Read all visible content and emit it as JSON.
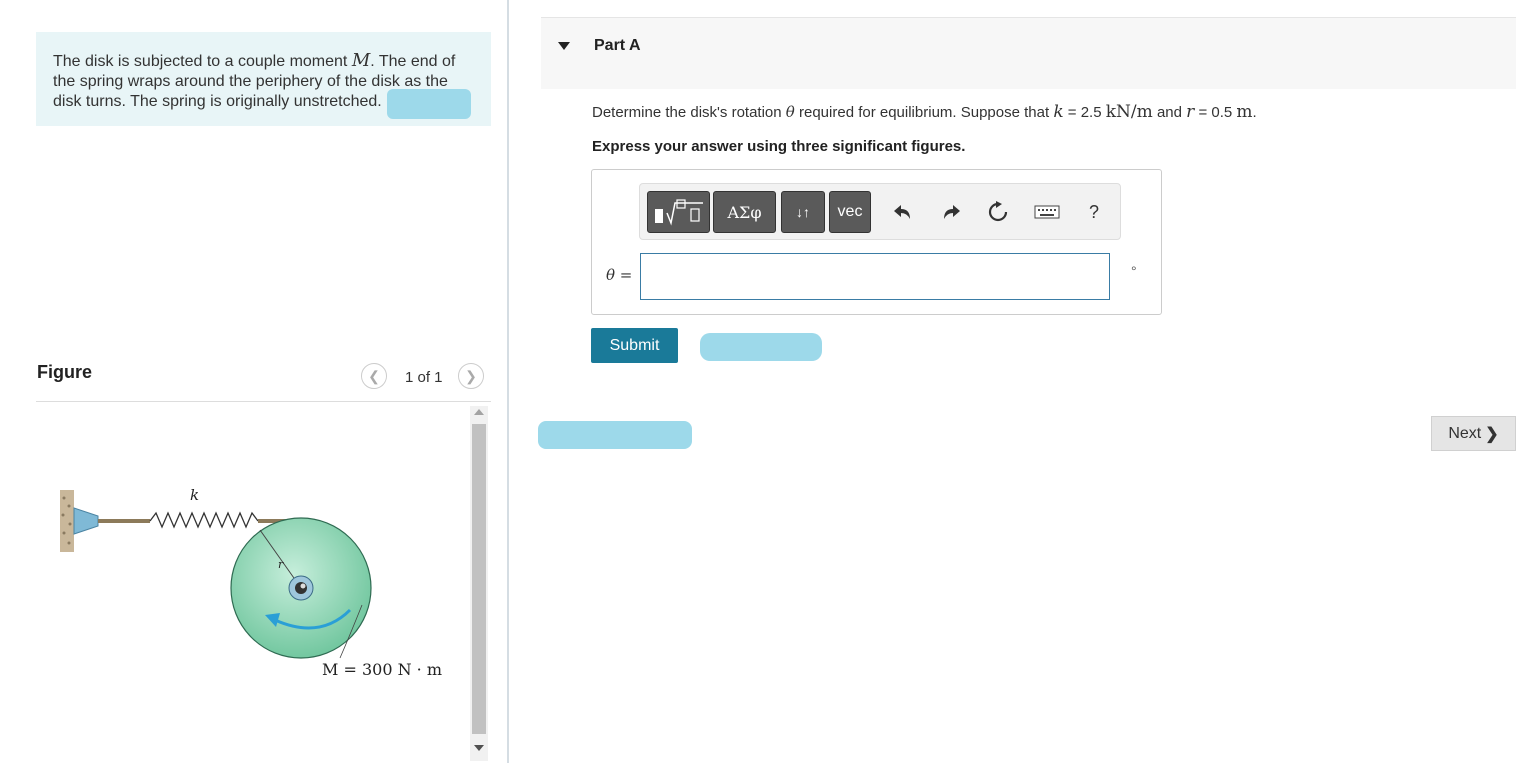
{
  "problem": {
    "text_part1": "The disk is subjected to a couple moment ",
    "moment_symbol": "M",
    "text_part2": ". The end of the spring wraps around the periphery of the disk as the disk turns. The spring is originally unstretched."
  },
  "figure": {
    "label": "Figure",
    "pager": "1 of 1",
    "prev_icon": "chevron-left-icon",
    "next_icon": "chevron-right-icon",
    "spring_label": "k",
    "radius_label": "r",
    "moment_label": "M = 300 N · m",
    "disk_color": "#7fcfa8",
    "arrow_color": "#2a9fd6"
  },
  "part_a": {
    "title": "Part A",
    "question_text1": "Determine the disk's rotation ",
    "theta": "θ",
    "question_text2": " required for equilibrium. Suppose that ",
    "k_sym": "k",
    "equals1": " = 2.5 ",
    "k_unit": "kN/m",
    "and": " and ",
    "r_sym": "r",
    "equals2": " = 0.5 ",
    "r_unit": "m",
    "period": ".",
    "instruction": "Express your answer using three significant figures.",
    "toolbar": {
      "btn_templates_icon": "fraction-sqrt-icon",
      "btn_greek": "ΑΣφ",
      "btn_arrows": "↓↑",
      "btn_vec": "vec",
      "undo_icon": "undo-icon",
      "redo_icon": "redo-icon",
      "reset_icon": "reset-icon",
      "keyboard_icon": "keyboard-icon",
      "help": "?"
    },
    "answer_label": "θ =",
    "answer_value": "",
    "unit": "°",
    "submit": "Submit"
  },
  "nav": {
    "next": "Next"
  },
  "colors": {
    "accent": "#1a7a99",
    "problem_bg": "#e8f5f7",
    "redaction": "#9dd9ea"
  }
}
